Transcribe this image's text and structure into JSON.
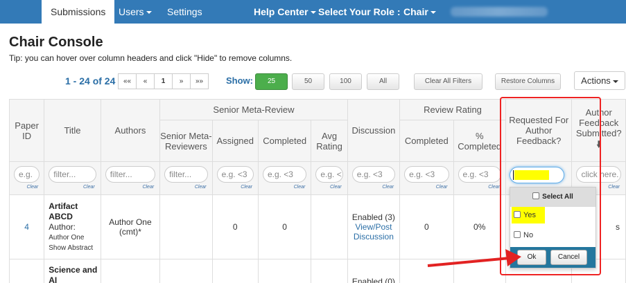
{
  "navbar": {
    "tabs": [
      {
        "label": "Submissions"
      },
      {
        "label": "Users"
      },
      {
        "label": "Settings"
      }
    ],
    "help_center": "Help Center",
    "role_label": "Select Your Role :",
    "role_value": "Chair"
  },
  "page": {
    "title": "Chair Console",
    "tip": "Tip: you can hover over column headers and click \"Hide\" to remove columns."
  },
  "pagination": {
    "range": "1 - 24 of 24",
    "buttons": [
      "««",
      "«",
      "1",
      "»",
      "»»"
    ],
    "show_label": "Show:",
    "page_sizes": [
      "25",
      "50",
      "100",
      "All"
    ],
    "selected_size": "25",
    "clear_filters": "Clear All Filters",
    "restore_columns": "Restore Columns",
    "actions": "Actions"
  },
  "table": {
    "group_headers": {
      "senior_meta_review": "Senior Meta-Review",
      "review_rating": "Review Rating"
    },
    "headers": {
      "paper_id": "Paper ID",
      "title": "Title",
      "authors": "Authors",
      "senior_meta_reviewers": "Senior Meta-Reviewers",
      "assigned": "Assigned",
      "completed": "Completed",
      "avg_rating": "Avg Rating",
      "discussion": "Discussion",
      "rr_completed": "Completed",
      "pct_completed": "% Completed",
      "requested_feedback": "Requested For Author Feedback?",
      "author_feedback": "Author Feedback Submitted?"
    },
    "filters": {
      "paper_id": "e.g.",
      "title": "filter...",
      "authors": "filter...",
      "senior": "filter...",
      "assigned": "e.g. <3",
      "completed": "e.g. <3",
      "avg_rating": "e.g. <",
      "discussion": "e.g. <3",
      "rr_completed": "e.g. <3",
      "pct_completed": "e.g. <3",
      "author_feedback": "click here.",
      "clear": "Clear"
    },
    "rows": [
      {
        "paper_id": "4",
        "title": "Artifact ABCD",
        "author_label": "Author:",
        "author_name": "Author One",
        "show_abstract": "Show Abstract",
        "authors": "Author One (cmt)*",
        "assigned": "0",
        "completed": "0",
        "discussion_status": "Enabled (3)",
        "discussion_link": "View/Post Discussion",
        "rr_completed": "0",
        "pct_completed": "0%",
        "author_feedback_partial": "s"
      },
      {
        "paper_id": "",
        "title": "Science and AI",
        "discussion_status": "Enabled (0)"
      }
    ]
  },
  "popup": {
    "select_all": "Select All",
    "options": [
      "Yes",
      "No"
    ],
    "ok": "Ok",
    "cancel": "Cancel"
  },
  "colors": {
    "navbar": "#337ab7",
    "annotation": "#e22222",
    "highlight": "#ffff00"
  }
}
